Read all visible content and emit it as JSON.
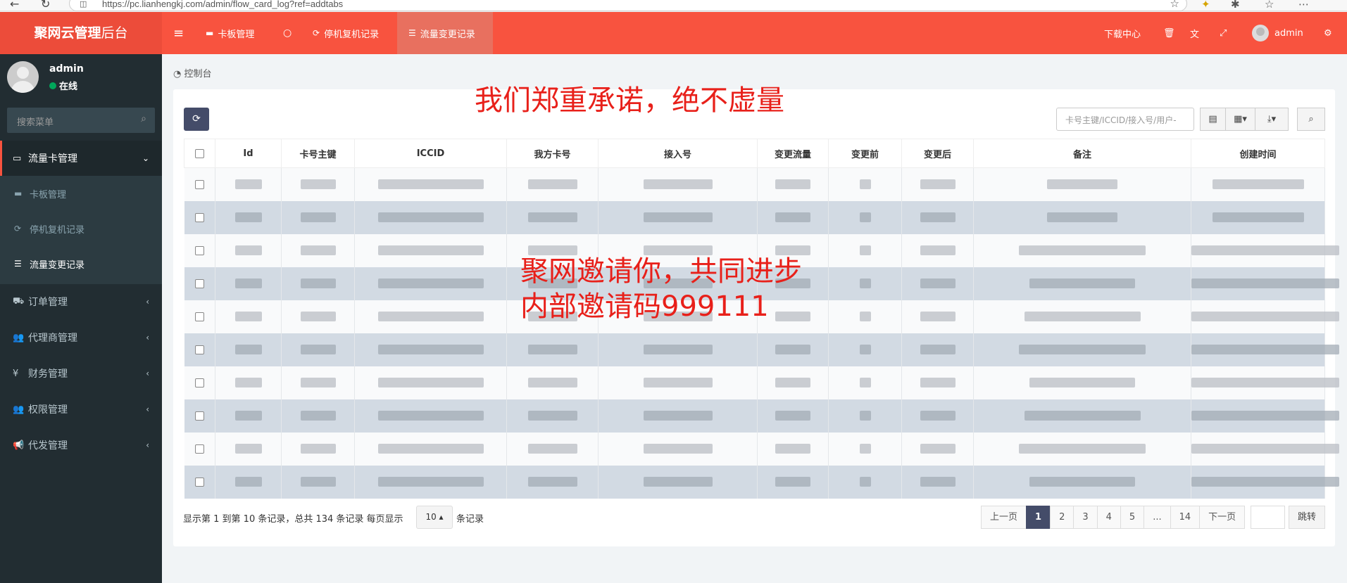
{
  "browser": {
    "url": "https://pc.lianhengkj.com/admin/flow_card_log?ref=addtabs"
  },
  "header": {
    "logo_bold": "聚网云管理",
    "logo_light": "后台",
    "nav": [
      {
        "label": "卡板管理",
        "icon": "card-icon"
      },
      {
        "label": "",
        "icon": "circle-icon"
      },
      {
        "label": "停机复机记录",
        "icon": "refresh-icon"
      },
      {
        "label": "流量变更记录",
        "icon": "list-icon"
      }
    ],
    "download_center": "下载中心",
    "user": "admin"
  },
  "sidebar": {
    "user_name": "admin",
    "status": "在线",
    "search_placeholder": "搜索菜单",
    "menu": [
      {
        "label": "流量卡管理",
        "icon": "card-icon",
        "open": true
      },
      {
        "label": "订单管理",
        "icon": "truck-icon"
      },
      {
        "label": "代理商管理",
        "icon": "users-icon"
      },
      {
        "label": "财务管理",
        "icon": "yen-icon"
      },
      {
        "label": "权限管理",
        "icon": "users-icon"
      },
      {
        "label": "代发管理",
        "icon": "bullhorn-icon"
      }
    ],
    "submenu": [
      {
        "label": "卡板管理",
        "icon": "card-icon"
      },
      {
        "label": "停机复机记录",
        "icon": "refresh-icon"
      },
      {
        "label": "流量变更记录",
        "icon": "list-icon",
        "active": true
      }
    ]
  },
  "breadcrumb": "控制台",
  "toolbar": {
    "search_placeholder": "卡号主键/ICCID/接入号/用户-"
  },
  "table": {
    "columns": [
      "Id",
      "卡号主键",
      "ICCID",
      "我方卡号",
      "接入号",
      "变更流量",
      "变更前",
      "变更后",
      "备注",
      "创建时间"
    ],
    "row_count": 10
  },
  "watermarks": {
    "line1": "我们郑重承诺，绝不虚量",
    "line2": "聚网邀请你，共同进步",
    "line3": "内部邀请码999111"
  },
  "pagination": {
    "info": "显示第 1 到第 10 条记录，总共 134 条记录 每页显示",
    "page_size": "10",
    "unit": "条记录",
    "prev": "上一页",
    "pages": [
      "1",
      "2",
      "3",
      "4",
      "5",
      "...",
      "14"
    ],
    "current": "1",
    "next": "下一页",
    "jump": "跳转"
  },
  "colors": {
    "accent": "#f8533f",
    "sidebar": "#222d32",
    "primary_button": "#444c69"
  }
}
